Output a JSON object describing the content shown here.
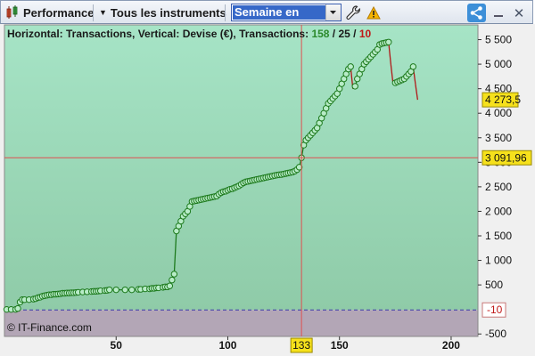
{
  "toolbar": {
    "performance_label": "Performance",
    "instruments_label": "Tous les instruments",
    "period_value": "Semaine en cours"
  },
  "header": {
    "prefix": "Horizontal: Transactions, Vertical: Devise (€), Transactions: ",
    "count_total": "158",
    "sep1": " / ",
    "count_win": "25",
    "sep2": " / ",
    "count_loss": "10"
  },
  "watermark": "© IT-Finance.com",
  "chart_data": {
    "type": "line",
    "xlabel": "",
    "ylabel": "",
    "xlim": [
      0,
      212
    ],
    "ylim": [
      -550,
      5800
    ],
    "x_ticks": [
      50,
      100,
      150,
      200
    ],
    "y_ticks": [
      -500,
      500,
      1000,
      1500,
      2000,
      2500,
      3000,
      3500,
      4000,
      4500,
      5000,
      5500
    ],
    "y_tick_labels": [
      "-500",
      "500",
      "1 000",
      "1 500",
      "2 000",
      "2 500",
      "3 000",
      "3 500",
      "4 000",
      "4 500",
      "5 000",
      "5 500"
    ],
    "zero_line_value": -10,
    "zero_line_label": "-10",
    "last_value": 4273.5,
    "last_value_label": "4 273,5",
    "crosshair_x": 133,
    "crosshair_x_label": "133",
    "crosshair_y": 3091.96,
    "crosshair_y_label": "3 091,96",
    "colors": {
      "area_positive": "#9fdcbe",
      "area_negative": "#b3a6b6",
      "line_up": "#1d7a1d",
      "line_down": "#b01818",
      "crosshair": "#e05050",
      "marker_fill": "#b8ecc8",
      "highlight": "#f6e11c"
    },
    "series": [
      {
        "points": [
          [
            1,
            0
          ],
          [
            2,
            0
          ],
          [
            3,
            0
          ],
          [
            4,
            0
          ],
          [
            5,
            0
          ],
          [
            6,
            20
          ],
          [
            7,
            150
          ],
          [
            8,
            200
          ],
          [
            9,
            200
          ],
          [
            10,
            200
          ],
          [
            11,
            200
          ],
          [
            12,
            200
          ],
          [
            13,
            210
          ],
          [
            14,
            220
          ],
          [
            15,
            240
          ],
          [
            16,
            250
          ],
          [
            17,
            270
          ],
          [
            18,
            280
          ],
          [
            19,
            290
          ],
          [
            20,
            300
          ],
          [
            21,
            300
          ],
          [
            22,
            310
          ],
          [
            23,
            310
          ],
          [
            24,
            315
          ],
          [
            25,
            320
          ],
          [
            26,
            330
          ],
          [
            27,
            330
          ],
          [
            28,
            335
          ],
          [
            29,
            335
          ],
          [
            30,
            340
          ],
          [
            31,
            340
          ],
          [
            32,
            345
          ],
          [
            33,
            350
          ],
          [
            34,
            350
          ],
          [
            35,
            355
          ],
          [
            36,
            355
          ],
          [
            37,
            360
          ],
          [
            38,
            360
          ],
          [
            39,
            365
          ],
          [
            40,
            370
          ],
          [
            41,
            370
          ],
          [
            42,
            375
          ],
          [
            43,
            380
          ],
          [
            44,
            380
          ],
          [
            45,
            385
          ],
          [
            46,
            390
          ],
          [
            47,
            400
          ],
          [
            48,
            400
          ],
          [
            50,
            400
          ],
          [
            52,
            400
          ],
          [
            54,
            400
          ],
          [
            55,
            400
          ],
          [
            57,
            400
          ],
          [
            60,
            410
          ],
          [
            61,
            410
          ],
          [
            62,
            410
          ],
          [
            63,
            420
          ],
          [
            64,
            420
          ],
          [
            65,
            420
          ],
          [
            66,
            430
          ],
          [
            67,
            430
          ],
          [
            68,
            440
          ],
          [
            69,
            440
          ],
          [
            70,
            440
          ],
          [
            71,
            450
          ],
          [
            72,
            460
          ],
          [
            73,
            460
          ],
          [
            74,
            480
          ],
          [
            75,
            600
          ],
          [
            76,
            720
          ],
          [
            77,
            1600
          ],
          [
            78,
            1700
          ],
          [
            79,
            1800
          ],
          [
            80,
            1900
          ],
          [
            81,
            1950
          ],
          [
            82,
            2000
          ],
          [
            83,
            2100
          ],
          [
            84,
            2200
          ],
          [
            85,
            2210
          ],
          [
            86,
            2220
          ],
          [
            87,
            2230
          ],
          [
            88,
            2240
          ],
          [
            89,
            2250
          ],
          [
            90,
            2260
          ],
          [
            91,
            2270
          ],
          [
            92,
            2280
          ],
          [
            93,
            2290
          ],
          [
            94,
            2300
          ],
          [
            95,
            2310
          ],
          [
            96,
            2350
          ],
          [
            97,
            2380
          ],
          [
            98,
            2400
          ],
          [
            99,
            2410
          ],
          [
            100,
            2430
          ],
          [
            101,
            2450
          ],
          [
            102,
            2460
          ],
          [
            103,
            2480
          ],
          [
            104,
            2500
          ],
          [
            105,
            2520
          ],
          [
            106,
            2550
          ],
          [
            107,
            2580
          ],
          [
            108,
            2600
          ],
          [
            109,
            2610
          ],
          [
            110,
            2620
          ],
          [
            111,
            2630
          ],
          [
            112,
            2640
          ],
          [
            113,
            2650
          ],
          [
            114,
            2660
          ],
          [
            115,
            2670
          ],
          [
            116,
            2680
          ],
          [
            117,
            2690
          ],
          [
            118,
            2700
          ],
          [
            119,
            2710
          ],
          [
            120,
            2720
          ],
          [
            121,
            2730
          ],
          [
            122,
            2740
          ],
          [
            123,
            2745
          ],
          [
            124,
            2750
          ],
          [
            125,
            2760
          ],
          [
            126,
            2770
          ],
          [
            127,
            2780
          ],
          [
            128,
            2790
          ],
          [
            129,
            2800
          ],
          [
            130,
            2820
          ],
          [
            131,
            2850
          ],
          [
            132,
            2900
          ],
          [
            133,
            3092
          ],
          [
            134,
            3350
          ],
          [
            135,
            3450
          ],
          [
            136,
            3500
          ],
          [
            137,
            3550
          ],
          [
            138,
            3600
          ],
          [
            139,
            3650
          ],
          [
            140,
            3700
          ],
          [
            141,
            3800
          ],
          [
            142,
            3900
          ],
          [
            143,
            4000
          ],
          [
            144,
            4100
          ],
          [
            145,
            4200
          ],
          [
            146,
            4250
          ],
          [
            147,
            4300
          ],
          [
            148,
            4350
          ],
          [
            149,
            4400
          ],
          [
            150,
            4500
          ],
          [
            151,
            4600
          ],
          [
            152,
            4700
          ],
          [
            153,
            4800
          ],
          [
            154,
            4900
          ],
          [
            155,
            4950
          ],
          [
            156,
            4500
          ],
          [
            157,
            4550
          ],
          [
            158,
            4700
          ],
          [
            159,
            4800
          ],
          [
            160,
            4900
          ],
          [
            161,
            5000
          ],
          [
            162,
            5050
          ],
          [
            163,
            5100
          ],
          [
            164,
            5150
          ],
          [
            165,
            5200
          ],
          [
            166,
            5250
          ],
          [
            167,
            5300
          ],
          [
            168,
            5400
          ],
          [
            169,
            5420
          ],
          [
            170,
            5430
          ],
          [
            171,
            5440
          ],
          [
            172,
            5450
          ],
          [
            173,
            5000
          ],
          [
            174,
            4600
          ],
          [
            175,
            4620
          ],
          [
            176,
            4640
          ],
          [
            177,
            4660
          ],
          [
            178,
            4680
          ],
          [
            179,
            4700
          ],
          [
            180,
            4750
          ],
          [
            181,
            4800
          ],
          [
            182,
            4850
          ],
          [
            183,
            4950
          ],
          [
            184,
            4600
          ],
          [
            185,
            4273.5
          ]
        ]
      }
    ]
  }
}
